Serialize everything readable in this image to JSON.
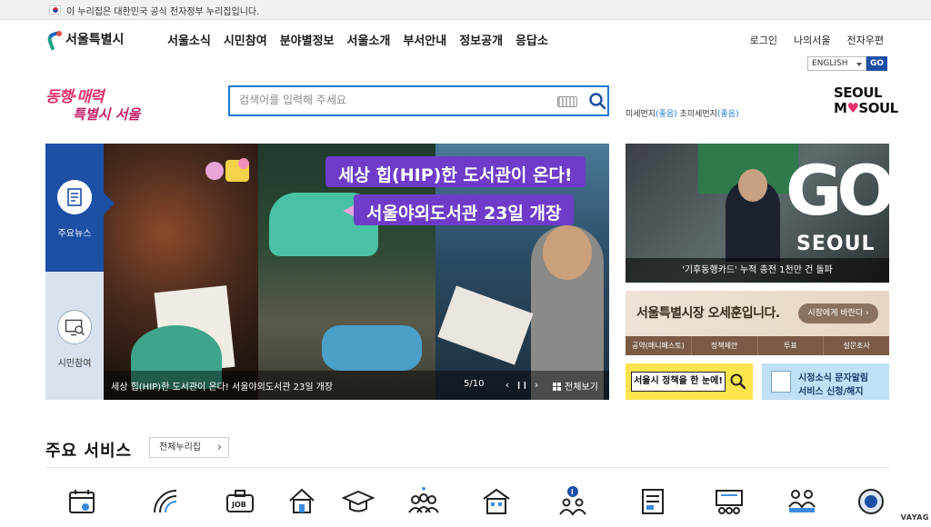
{
  "gov_notice": "이 누리집은 대한민국 공식 전자정부 누리집입니다.",
  "logo": {
    "name": "서울특별시"
  },
  "gnb": [
    "서울소식",
    "시민참여",
    "분야별정보",
    "서울소개",
    "부서안내",
    "정보공개",
    "응답소"
  ],
  "util": [
    "로그인",
    "나의서울",
    "전자우편"
  ],
  "language": {
    "selected": "ENGLISH",
    "go": "GO"
  },
  "slogan": {
    "line1": "동행·매력",
    "line2": "특별시 서울"
  },
  "search": {
    "placeholder": "검색어를 입력해 주세요"
  },
  "air_quality": {
    "fine_dust_label": "미세먼지",
    "fine_dust_value": "(좋음)",
    "ultra_fine_dust_label": "초미세먼지",
    "ultra_fine_dust_value": "(좋음)"
  },
  "brand": {
    "line1": "SEOUL",
    "line2a": "M",
    "line2b": "♥",
    "line2c": "SOUL"
  },
  "side_tabs": {
    "news": "주요뉴스",
    "citizen": "시민참여"
  },
  "banner": {
    "title1": "세상 힙(HIP)한 도서관이 온다!",
    "title2": "서울야외도서관 23일 개장",
    "caption": "세상 힙(HIP)한 도서관이 온다! 서울야외도서관 23일 개장",
    "counter": "5/10",
    "prev": "‹",
    "pause": "❙❙",
    "next": "›",
    "view_all": "전체보기"
  },
  "news_card": {
    "caption": "'기후동행카드' 누적 충전 1천만 건 돌파",
    "go": "GO",
    "seoul": "SEOUL"
  },
  "mayor": {
    "title": "서울특별시장 오세훈입니다.",
    "button": "시장에게 바란다 ›",
    "links": [
      "공약(매니페스토)",
      "정책제안",
      "투표",
      "설문조사"
    ]
  },
  "policy": {
    "label": "서울시 정책을 한 눈에!"
  },
  "sms": {
    "line1": "시정소식 문자알림",
    "line2": "서비스 신청/해지"
  },
  "services": {
    "title": "주요 서비스",
    "view_all": "전체누리집"
  },
  "watermark": "VAYAG",
  "colors": {
    "primary": "#1d4fa5",
    "search_border": "#1d7ad6",
    "banner_title": "#6e3cc8",
    "slogan": "#e4316c"
  }
}
